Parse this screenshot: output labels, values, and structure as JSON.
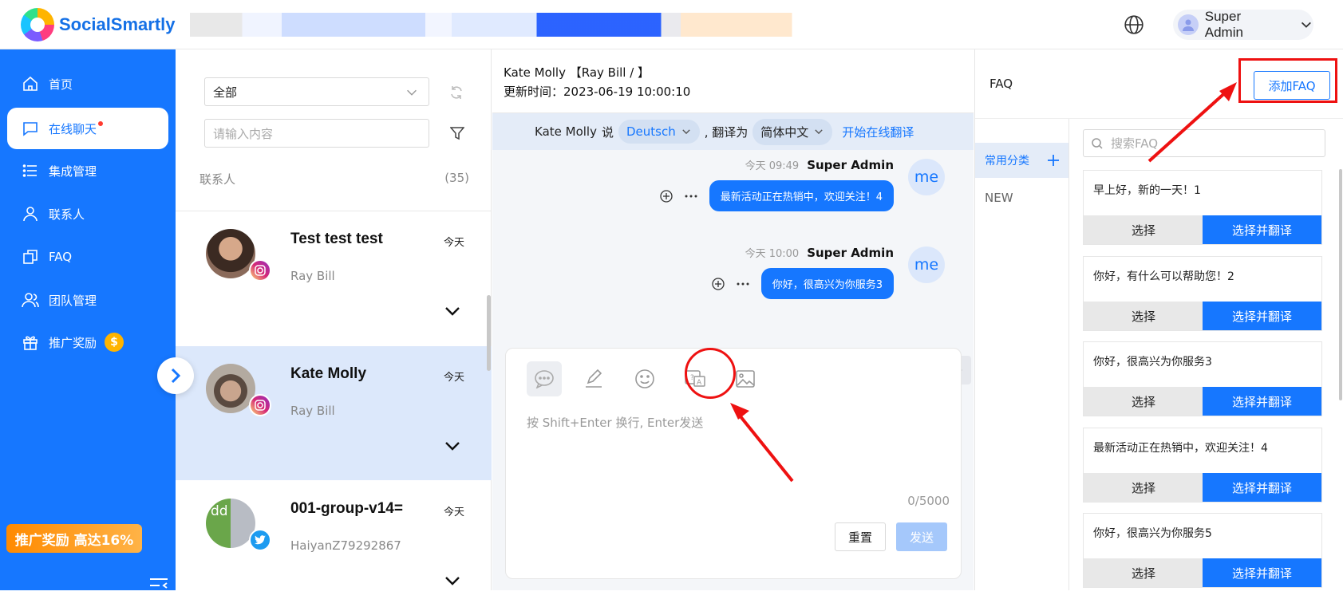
{
  "app": {
    "name": "SocialSmartly"
  },
  "header": {
    "user_name": "Super Admin"
  },
  "sidebar": {
    "items": [
      {
        "label": "首页"
      },
      {
        "label": "在线聊天"
      },
      {
        "label": "集成管理"
      },
      {
        "label": "联系人"
      },
      {
        "label": "FAQ"
      },
      {
        "label": "团队管理"
      },
      {
        "label": "推广奖励"
      }
    ],
    "coin_symbol": "$",
    "promo": "推广奖励 高达16%"
  },
  "contacts": {
    "filter_value": "全部",
    "search_placeholder": "请输入内容",
    "header_label": "联系人",
    "count": "(35)",
    "list": [
      {
        "name": "Test test test",
        "time": "今天",
        "sub": "Ray Bill",
        "channel": "instagram"
      },
      {
        "name": "Kate Molly",
        "time": "今天",
        "sub": "Ray Bill",
        "channel": "instagram"
      },
      {
        "name": "001-group-v14=",
        "time": "今天",
        "sub": "HaiyanZ79292867",
        "channel": "twitter",
        "avatar_text": "dd"
      }
    ]
  },
  "chat": {
    "title": "Kate Molly 【Ray Bill / 】",
    "updated": "更新时间：2023-06-19 10:00:10",
    "translate": {
      "speaker": "Kate Molly",
      "says": "说",
      "source_lang": "Deutsch",
      "to_label": ", 翻译为",
      "target_lang": "简体中文",
      "start_link": "开始在线翻译"
    },
    "messages": [
      {
        "time": "今天 09:49",
        "sender": "Super Admin",
        "text": "最新活动正在热销中，欢迎关注！4",
        "avatar": "me"
      },
      {
        "time": "今天 10:00",
        "sender": "Super Admin",
        "text": "你好，很高兴为你服务3",
        "avatar": "me"
      }
    ],
    "composer": {
      "placeholder": "按 Shift+Enter 换行, Enter发送",
      "counter": "0/5000",
      "reset_label": "重置",
      "send_label": "发送"
    }
  },
  "faq": {
    "title": "FAQ",
    "add_label": "添加FAQ",
    "category_head": "常用分类",
    "categories": [
      "NEW"
    ],
    "search_placeholder": "搜索FAQ",
    "choose_label": "选择",
    "choose_translate_label": "选择并翻译",
    "items": [
      "早上好，新的一天！1",
      "你好，有什么可以帮助您！2",
      "你好，很高兴为你服务3",
      "最新活动正在热销中，欢迎关注！4",
      "你好，很高兴为你服务5"
    ]
  },
  "colors": {
    "primary": "#1677ff",
    "annotation": "#ee1111"
  }
}
